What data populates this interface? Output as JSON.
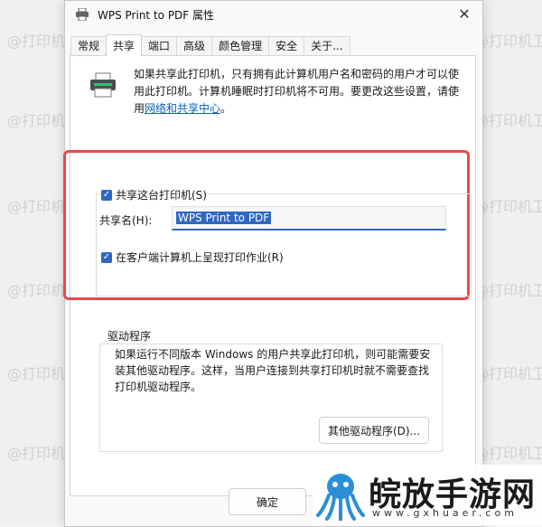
{
  "window": {
    "title": "WPS Print to PDF 属性",
    "close_glyph": "✕"
  },
  "tabs": [
    "常规",
    "共享",
    "端口",
    "高级",
    "颜色管理",
    "安全",
    "关于..."
  ],
  "active_tab": "共享",
  "info": {
    "text": "如果共享此打印机，只有拥有此计算机用户名和密码的用户才可以使用此打印机。计算机睡眠时打印机将不可用。要更改这些设置，请使用",
    "link": "网络和共享中心",
    "suffix": "。"
  },
  "share": {
    "checkbox_label": "共享这台打印机(S)",
    "name_label": "共享名(H):",
    "name_value": "WPS Print to PDF",
    "render_label": "在客户端计算机上呈现打印作业(R)"
  },
  "drivers": {
    "legend": "驱动程序",
    "text": "如果运行不同版本 Windows 的用户共享此打印机，则可能需要安装其他驱动程序。这样，当用户连接到共享打印机时就不需要查找打印机驱动程序。",
    "button": "其他驱动程序(D)..."
  },
  "footer": {
    "ok": "确定"
  },
  "watermark": "@打印机卫士",
  "logo": {
    "text": "皖放手游网",
    "url": "www.gxhuaer.com"
  },
  "colors": {
    "accent": "#2f67c2",
    "highlight": "#e8494a",
    "link": "#0a5fbf"
  },
  "icons": [
    "printer-icon",
    "close-icon",
    "checkbox-checked-icon",
    "octopus-logo-icon"
  ]
}
